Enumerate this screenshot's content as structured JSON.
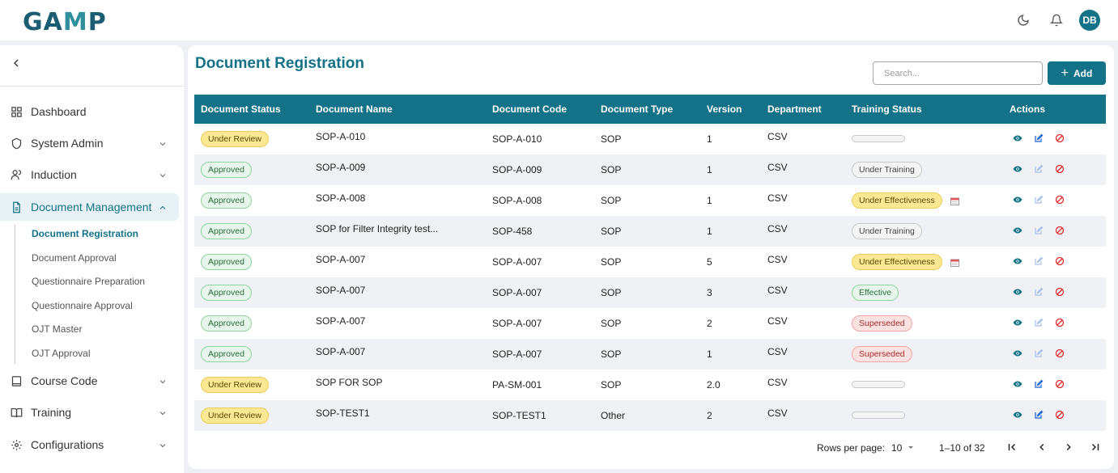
{
  "app": {
    "logo_main": "GA",
    "logo_accent": "M",
    "logo_end": "P",
    "user_initials": "DB"
  },
  "sidebar": {
    "items": [
      {
        "label": "Dashboard",
        "icon": "grid-icon"
      },
      {
        "label": "System Admin",
        "icon": "shield-icon"
      },
      {
        "label": "Induction",
        "icon": "users-icon"
      },
      {
        "label": "Document Management",
        "icon": "document-icon"
      },
      {
        "label": "Course Code",
        "icon": "book-icon"
      },
      {
        "label": "Training",
        "icon": "open-book-icon"
      },
      {
        "label": "Configurations",
        "icon": "gear-icon"
      }
    ],
    "sub_items": [
      "Document Registration",
      "Document Approval",
      "Questionnaire Preparation",
      "Questionnaire Approval",
      "OJT Master",
      "OJT Approval"
    ]
  },
  "main": {
    "title": "Document Registration",
    "search_placeholder": "Search...",
    "add_label": "Add"
  },
  "table": {
    "headers": [
      "Document Status",
      "Document Name",
      "Document Code",
      "Document Type",
      "Version",
      "Department",
      "Training Status",
      "Actions"
    ],
    "rows": [
      {
        "status": "Under Review",
        "name": "SOP-A-010",
        "code": "SOP-A-010",
        "type": "SOP",
        "version": "1",
        "dept": "CSV",
        "training": ""
      },
      {
        "status": "Approved",
        "name": "SOP-A-009",
        "code": "SOP-A-009",
        "type": "SOP",
        "version": "1",
        "dept": "CSV",
        "training": "Under Training"
      },
      {
        "status": "Approved",
        "name": "SOP-A-008",
        "code": "SOP-A-008",
        "type": "SOP",
        "version": "1",
        "dept": "CSV",
        "training": "Under Effectiveness"
      },
      {
        "status": "Approved",
        "name": "SOP for Filter Integrity test...",
        "code": "SOP-458",
        "type": "SOP",
        "version": "1",
        "dept": "CSV",
        "training": "Under Training"
      },
      {
        "status": "Approved",
        "name": "SOP-A-007",
        "code": "SOP-A-007",
        "type": "SOP",
        "version": "5",
        "dept": "CSV",
        "training": "Under Effectiveness"
      },
      {
        "status": "Approved",
        "name": "SOP-A-007",
        "code": "SOP-A-007",
        "type": "SOP",
        "version": "3",
        "dept": "CSV",
        "training": "Effective"
      },
      {
        "status": "Approved",
        "name": "SOP-A-007",
        "code": "SOP-A-007",
        "type": "SOP",
        "version": "2",
        "dept": "CSV",
        "training": "Superseded"
      },
      {
        "status": "Approved",
        "name": "SOP-A-007",
        "code": "SOP-A-007",
        "type": "SOP",
        "version": "1",
        "dept": "CSV",
        "training": "Superseded"
      },
      {
        "status": "Under Review",
        "name": "SOP FOR SOP",
        "code": "PA-SM-001",
        "type": "SOP",
        "version": "2.0",
        "dept": "CSV",
        "training": ""
      },
      {
        "status": "Under Review",
        "name": "SOP-TEST1",
        "code": "SOP-TEST1",
        "type": "Other",
        "version": "2",
        "dept": "CSV",
        "training": ""
      }
    ]
  },
  "pagination": {
    "rows_label": "Rows per page:",
    "rows_value": "10",
    "range": "1–10 of 32"
  },
  "colors": {
    "primary": "#137287",
    "review": "#fbe892",
    "approved": "#e6f6ea",
    "superseded": "#fde2e2",
    "delete": "#e02424"
  }
}
